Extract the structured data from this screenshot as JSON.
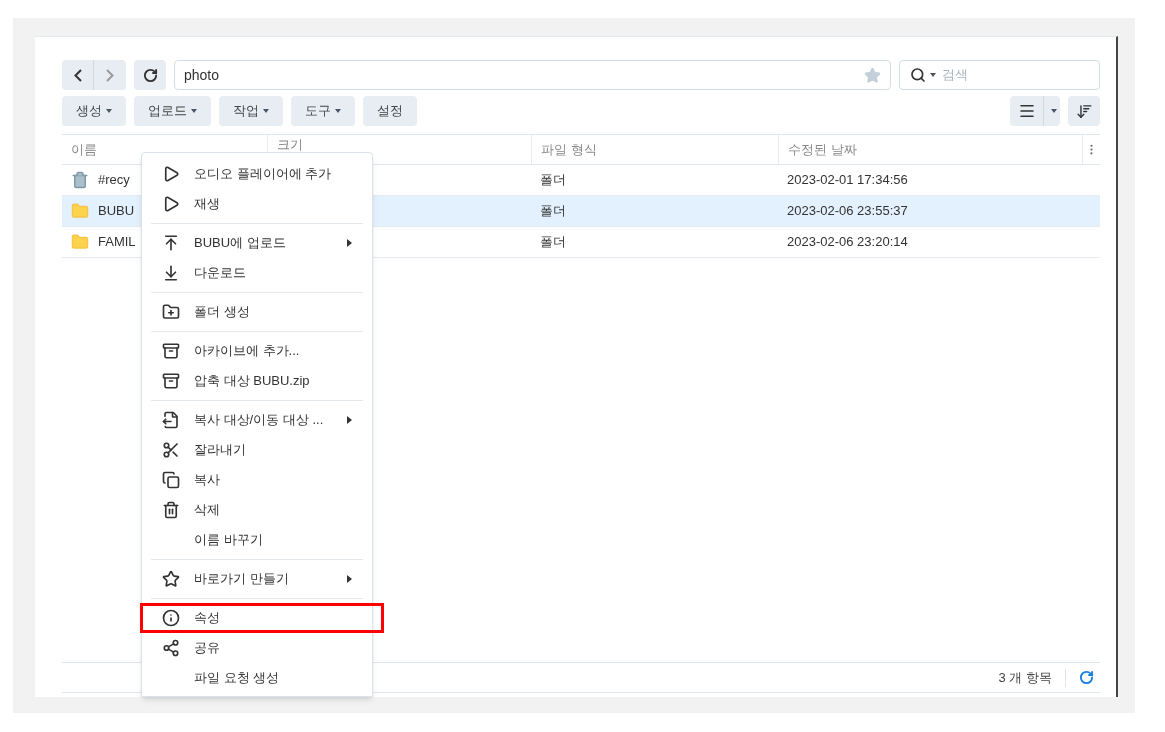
{
  "path": "photo",
  "search": {
    "placeholder": "검색"
  },
  "toolbar": [
    {
      "label": "생성",
      "dropdown": true
    },
    {
      "label": "업로드",
      "dropdown": true
    },
    {
      "label": "작업",
      "dropdown": true
    },
    {
      "label": "도구",
      "dropdown": true
    },
    {
      "label": "설정",
      "dropdown": false
    }
  ],
  "table": {
    "columns": [
      "이름",
      "크기",
      "파일 형식",
      "수정된 날짜"
    ],
    "rows": [
      {
        "kind": "trash",
        "name": "#recy",
        "type": "폴더",
        "modified": "2023-02-01 17:34:56",
        "selected": false
      },
      {
        "kind": "folder",
        "name": "BUBU",
        "type": "폴더",
        "modified": "2023-02-06 23:55:37",
        "selected": true
      },
      {
        "kind": "folder",
        "name": "FAMIL",
        "type": "폴더",
        "modified": "2023-02-06 23:20:14",
        "selected": false
      }
    ]
  },
  "status_bar": {
    "count": "3 개 항목"
  },
  "context_menu": [
    {
      "kind": "item",
      "label": "오디오 플레이어에 추가",
      "submenu": false,
      "highlighted": false
    },
    {
      "kind": "item",
      "label": "재생",
      "submenu": false,
      "highlighted": false
    },
    {
      "kind": "separator"
    },
    {
      "kind": "item",
      "label": "BUBU에 업로드",
      "submenu": true,
      "highlighted": false
    },
    {
      "kind": "item",
      "label": "다운로드",
      "submenu": false,
      "highlighted": false
    },
    {
      "kind": "separator"
    },
    {
      "kind": "item",
      "label": "폴더 생성",
      "submenu": false,
      "highlighted": false
    },
    {
      "kind": "separator"
    },
    {
      "kind": "item",
      "label": "아카이브에 추가...",
      "submenu": false,
      "highlighted": false
    },
    {
      "kind": "item",
      "label": "압축 대상 BUBU.zip",
      "submenu": false,
      "highlighted": false
    },
    {
      "kind": "separator"
    },
    {
      "kind": "item",
      "label": "복사 대상/이동 대상 ...",
      "submenu": true,
      "highlighted": false
    },
    {
      "kind": "item",
      "label": "잘라내기",
      "submenu": false,
      "highlighted": false
    },
    {
      "kind": "item",
      "label": "복사",
      "submenu": false,
      "highlighted": false
    },
    {
      "kind": "item",
      "label": "삭제",
      "submenu": false,
      "highlighted": false
    },
    {
      "kind": "item",
      "label": "이름 바꾸기",
      "submenu": false,
      "highlighted": false
    },
    {
      "kind": "separator"
    },
    {
      "kind": "item",
      "label": "바로가기 만들기",
      "submenu": true,
      "highlighted": false
    },
    {
      "kind": "separator"
    },
    {
      "kind": "item",
      "label": "속성",
      "submenu": false,
      "highlighted": true
    },
    {
      "kind": "item",
      "label": "공유",
      "submenu": false,
      "highlighted": false
    },
    {
      "kind": "item",
      "label": "파일 요청 생성",
      "submenu": false,
      "highlighted": false
    }
  ]
}
